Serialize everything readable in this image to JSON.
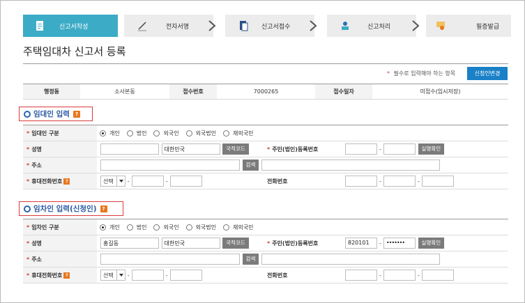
{
  "steps": [
    {
      "label": "신고서작성",
      "active": true
    },
    {
      "label": "전자서명",
      "active": false
    },
    {
      "label": "신고서접수",
      "active": false
    },
    {
      "label": "신고처리",
      "active": false
    },
    {
      "label": "필증발급",
      "active": false
    }
  ],
  "page_title": "주택임대차 신고서 등록",
  "required_note": "필수로 입력해야 하는 항목",
  "required_star": "*",
  "change_button": "신청인변경",
  "info": {
    "h1": "행정동",
    "v1": "소사본동",
    "h2": "접수번호",
    "v2": "7000265",
    "h3": "접수일자",
    "v3": "미접수(임시저장)"
  },
  "lessor": {
    "section_title": "임대인 입력",
    "section_help": "?",
    "type_label": "임대인 구분",
    "type_options": [
      "개인",
      "법인",
      "외국인",
      "외국법인",
      "재외국민"
    ],
    "selected_type": "개인",
    "name_label": "성명",
    "name_value": "",
    "nationality_value": "대한민국",
    "country_code_button": "국적코드",
    "id_label": "주민(법인)등록번호",
    "id_front": "",
    "id_back": "",
    "verify_button": "실명확인",
    "address_label": "주소",
    "search_button": "검색",
    "mobile_label": "휴대전화번호",
    "mobile_select": "선택",
    "phone_label": "전화번호"
  },
  "lessee": {
    "section_title": "임차인 입력(신청인)",
    "section_help": "?",
    "type_label": "임차인 구분",
    "type_options": [
      "개인",
      "법인",
      "외국인",
      "외국법인",
      "재외국민"
    ],
    "selected_type": "개인",
    "name_label": "성명",
    "name_value": "홍길동",
    "nationality_value": "대한민국",
    "country_code_button": "국적코드",
    "id_label": "주민(법인)등록번호",
    "id_front": "820101",
    "id_back": "•••••••",
    "verify_button": "실명확인",
    "address_label": "주소",
    "search_button": "검색",
    "mobile_label": "휴대전화번호",
    "mobile_select": "선택",
    "phone_label": "전화번호"
  },
  "colors": {
    "accent": "#3cabc6",
    "brand_blue": "#1a80c7",
    "required_red": "#d93a3a",
    "help_orange": "#e8781e"
  }
}
